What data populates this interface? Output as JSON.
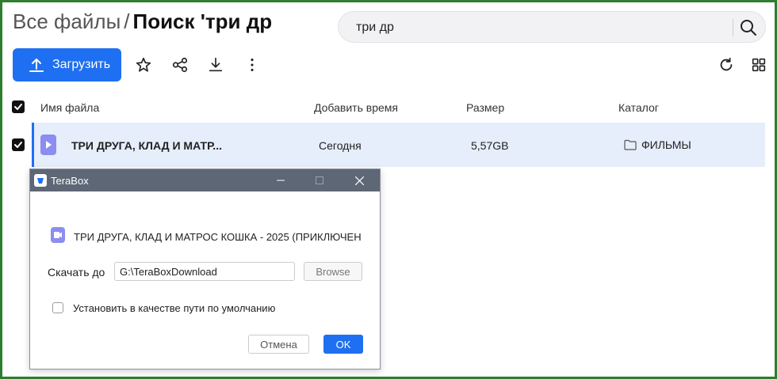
{
  "header": {
    "breadcrumb_root": "Все файлы",
    "separator": "/",
    "current": "Поиск 'три др"
  },
  "search": {
    "value": "три др",
    "icon": "search-icon"
  },
  "toolbar": {
    "upload_label": "Загрузить",
    "icons": [
      "star-icon",
      "share-icon",
      "download-icon",
      "more-icon",
      "refresh-icon",
      "grid-view-icon"
    ]
  },
  "table": {
    "columns": [
      "Имя файла",
      "Добавить время",
      "Размер",
      "Каталог"
    ],
    "rows": [
      {
        "name": "ТРИ ДРУГА, КЛАД И МАТР...",
        "time": "Сегодня",
        "size": "5,57GB",
        "folder": "ФИЛЬМЫ",
        "checked": true
      }
    ]
  },
  "dialog": {
    "title": "TeraBox",
    "file_name": "ТРИ ДРУГА, КЛАД И МАТРОС КОШКА - 2025 (ПРИКЛЮЧЕН",
    "download_to_label": "Скачать до",
    "path_value": "G:\\TeraBoxDownload",
    "browse_label": "Browse",
    "default_path_label": "Установить в качестве пути по умолчанию",
    "default_path_checked": false,
    "cancel_label": "Отмена",
    "ok_label": "OK"
  },
  "colors": {
    "accent": "#1f6ff2",
    "selected_row": "#e6eefb",
    "dialog_titlebar": "#5d6775",
    "video_icon": "#8c8cf2"
  }
}
